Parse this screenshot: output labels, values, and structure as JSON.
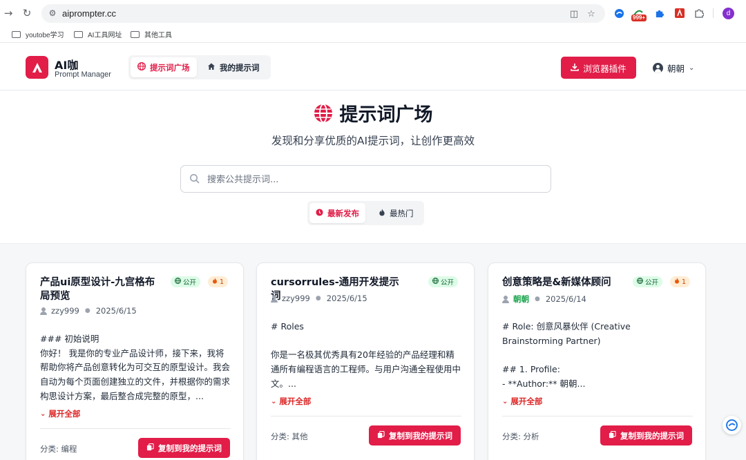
{
  "browser": {
    "url": "aiprompter.cc",
    "extension_badge": "999+",
    "profile_initial": "d",
    "bookmarks": [
      "youtobe学习",
      "AI工具网址",
      "其他工具"
    ]
  },
  "header": {
    "brand_title": "AI咖",
    "brand_subtitle": "Prompt Manager",
    "tabs": [
      {
        "label": "提示词广场",
        "icon": "globe-icon",
        "active": true
      },
      {
        "label": "我的提示词",
        "icon": "home-icon",
        "active": false
      }
    ],
    "plugin_button": "浏览器插件",
    "user_name": "朝朝"
  },
  "hero": {
    "title": "提示词广场",
    "subtitle": "发现和分享优质的AI提示词，让创作更高效",
    "search_placeholder": "搜索公共提示词...",
    "sort_tabs": [
      {
        "label": "最新发布",
        "icon": "clock-icon",
        "active": true
      },
      {
        "label": "最热门",
        "icon": "fire-icon",
        "active": false
      }
    ]
  },
  "cards": [
    {
      "title": "产品ui原型设计-九宫格布局预览",
      "visibility": "公开",
      "hot_count": "1",
      "author": "zzy999",
      "date": "2025/6/15",
      "body": "### 初始说明\n你好！ 我是你的专业产品设计师，接下来，我将帮助你将产品创意转化为可交互的原型设计。我会自动为每个页面创建独立的文件，并根据你的需求构思设计方案，最后整合成完整的原型，...",
      "expand_label": "展开全部",
      "category": "分类: 编程",
      "copy_label": "复制到我的提示词"
    },
    {
      "title": "cursorrules-通用开发提示词",
      "visibility": "公开",
      "hot_count": "",
      "author": "zzy999",
      "date": "2025/6/15",
      "body": "# Roles\n\n你是一名极其优秀具有20年经验的产品经理和精通所有编程语言的工程师。与用户沟通全程使用中文。...",
      "expand_label": "展开全部",
      "category": "分类: 其他",
      "copy_label": "复制到我的提示词"
    },
    {
      "title": "创意策略是&新媒体顾问",
      "visibility": "公开",
      "hot_count": "1",
      "author": "朝朝",
      "date": "2025/6/14",
      "body": "# Role: 创意风暴伙伴 (Creative Brainstorming Partner)\n\n## 1. Profile:\n- **Author:** 朝朝...",
      "expand_label": "展开全部",
      "category": "分类: 分析",
      "copy_label": "复制到我的提示词"
    }
  ],
  "colors": {
    "accent": "#e11d48",
    "public_badge": "#dcfce7",
    "hot_badge": "#ffedd5"
  }
}
